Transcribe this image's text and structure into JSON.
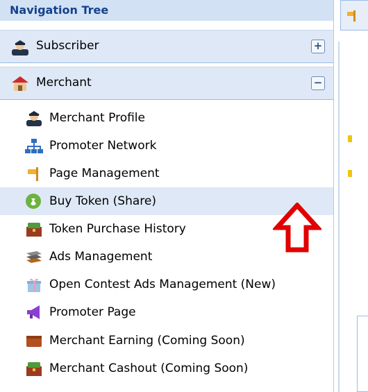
{
  "tree": {
    "title": "Navigation Tree",
    "sections": {
      "subscriber": {
        "label": "Subscriber",
        "toggle": "+"
      },
      "merchant": {
        "label": "Merchant",
        "toggle": "−"
      }
    },
    "items": [
      {
        "label": "Merchant Profile"
      },
      {
        "label": "Promoter Network"
      },
      {
        "label": "Page Management"
      },
      {
        "label": "Buy Token (Share)"
      },
      {
        "label": "Token Purchase History"
      },
      {
        "label": "Ads Management"
      },
      {
        "label": "Open Contest Ads Management (New)"
      },
      {
        "label": "Promoter Page"
      },
      {
        "label": "Merchant Earning (Coming Soon)"
      },
      {
        "label": "Merchant Cashout (Coming Soon)"
      }
    ]
  },
  "colors": {
    "title_bg": "#d2e1f4",
    "title_text": "#15428b",
    "section_bg": "#dfe8f6",
    "selected_bg": "#dfe8f6",
    "annotation_arrow": "#e00000"
  }
}
